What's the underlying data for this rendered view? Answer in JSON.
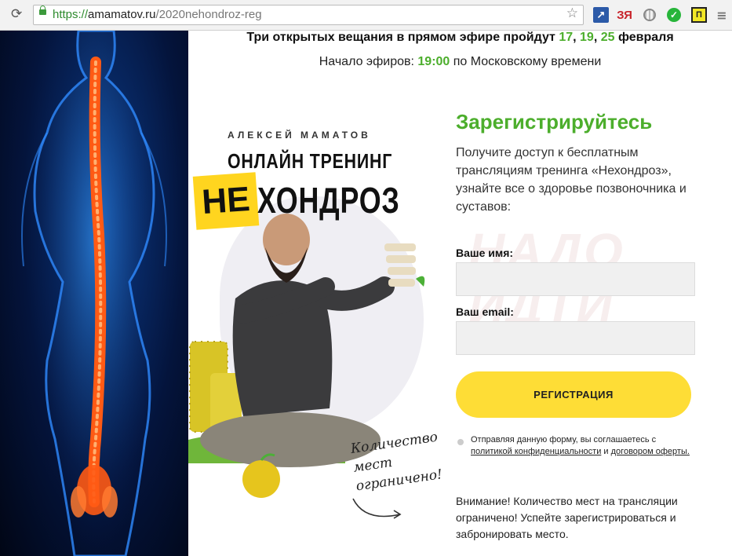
{
  "browser": {
    "url_scheme": "https://",
    "url_domain": "amamatov.ru",
    "url_path": "/2020nehondroz-reg",
    "icons": [
      "refresh-icon",
      "lock-icon",
      "star-icon",
      "extension-icon",
      "yandex-icon",
      "globe-icon",
      "check-icon",
      "extension-p-icon",
      "menu-icon"
    ],
    "ext_yandex_label": "ЗЯ",
    "ext_p_label": "П"
  },
  "header": {
    "announce_prefix": "Три открытых вещания в прямом эфире пройдут",
    "dates": [
      "17",
      "19",
      "25"
    ],
    "date_sep": ", ",
    "month": "февраля",
    "time_prefix": "Начало эфиров:",
    "time": "19:00",
    "time_suffix": "по Московскому времени"
  },
  "promo": {
    "author": "АЛЕКСЕЙ МАМАТОВ",
    "subtitle": "ОНЛАЙН ТРЕНИНГ",
    "brand_highlight": "НЕ",
    "brand_rest": "ХОНДРОЗ",
    "limited_lines": [
      "Количество",
      "мест",
      "ограничено!"
    ]
  },
  "form": {
    "title": "Зарегистрируйтесь",
    "description": "Получите доступ к бесплатным трансляциям тренинга «Нехондроз», узнайте все о здоровье позвоночника и суставов:",
    "watermark_lines": [
      "НАДО",
      "ИДТИ"
    ],
    "name_label": "Ваше имя:",
    "email_label": "Ваш email:",
    "name_value": "",
    "email_value": "",
    "submit_label": "РЕГИСТРАЦИЯ",
    "consent_text": "Отправляя данную форму, вы соглашаетесь с",
    "privacy_link": "политикой конфиденциальности",
    "and_word": "и",
    "offer_link": "договором оферты.",
    "warning": "Внимание! Количество мест на трансляции ограничено! Успейте зарегистрироваться и забронировать место."
  },
  "colors": {
    "accent_green": "#4cae2c",
    "button_yellow": "#fedd36",
    "badge_yellow": "#ffd51f",
    "spine_orange": "#ff5a14"
  }
}
